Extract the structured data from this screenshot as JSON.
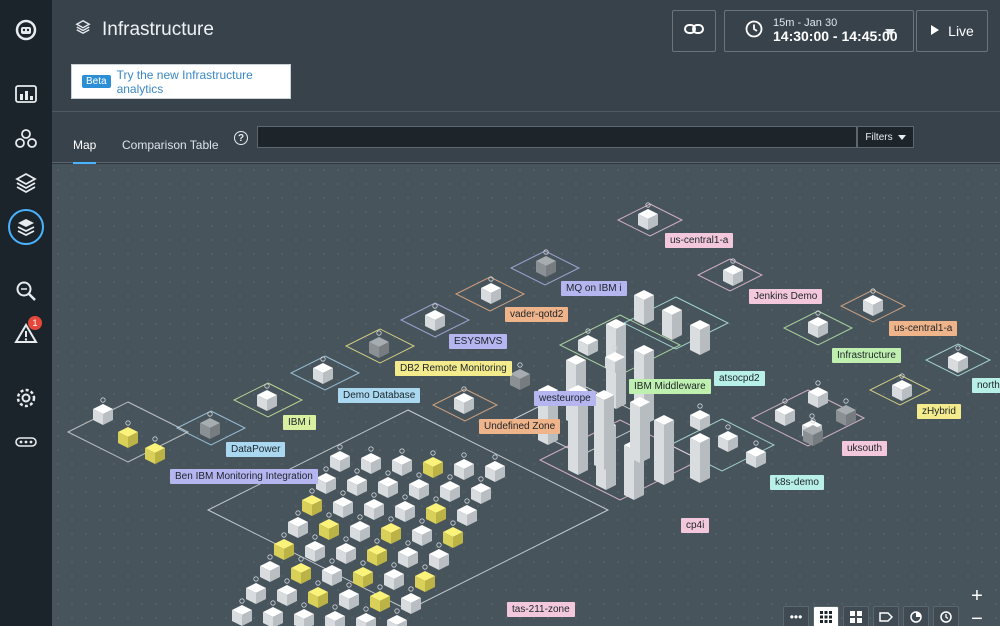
{
  "header": {
    "title": "Infrastructure",
    "time_range": "15m - Jan 30",
    "time_value": "14:30:00 - 14:45:00",
    "live_label": "Live"
  },
  "beta": {
    "tag": "Beta",
    "text": "Try the new Infrastructure analytics"
  },
  "tabs": [
    {
      "label": "Map",
      "active": true
    },
    {
      "label": "Comparison Table",
      "active": false
    }
  ],
  "search": {
    "value": "",
    "placeholder": ""
  },
  "filters_label": "Filters",
  "sidebar": {
    "items": [
      {
        "icon": "instana-logo-icon"
      },
      {
        "icon": "dashboard-icon"
      },
      {
        "icon": "applications-icon"
      },
      {
        "icon": "platforms-icon"
      },
      {
        "icon": "infrastructure-icon",
        "active": true
      },
      {
        "icon": "analytics-icon"
      },
      {
        "icon": "events-icon",
        "badge": "1"
      },
      {
        "icon": "settings-icon"
      },
      {
        "icon": "more-icon"
      }
    ]
  },
  "map": {
    "zones": [
      {
        "name": "us-central1-a",
        "color": "#f4c8dc"
      },
      {
        "name": "Jenkins Demo",
        "color": "#f4c8dc"
      },
      {
        "name": "us-central1-a",
        "color": "#f0b48a"
      },
      {
        "name": "MQ on IBM i",
        "color": "#b5b5f0"
      },
      {
        "name": "vader-qotd2",
        "color": "#f0b48a"
      },
      {
        "name": "ESYSMVS",
        "color": "#b5b5f0"
      },
      {
        "name": "DB2 Remote Monitoring",
        "color": "#f4eb8c"
      },
      {
        "name": "Demo Database",
        "color": "#a9d8f0"
      },
      {
        "name": "IBM i",
        "color": "#d8f0a0"
      },
      {
        "name": "DataPower",
        "color": "#a9d8f0"
      },
      {
        "name": "Ben IBM Monitoring Integration",
        "color": "#b5b5f0"
      },
      {
        "name": "Undefined Zone",
        "color": "#f0b48a"
      },
      {
        "name": "westeurope",
        "color": "#b5b5f0"
      },
      {
        "name": "IBM Middleware",
        "color": "#c0f0b0"
      },
      {
        "name": "atsocpd2",
        "color": "#b8f0e8"
      },
      {
        "name": "Infrastructure",
        "color": "#c0f0b0"
      },
      {
        "name": "zHybrid",
        "color": "#f4eb8c"
      },
      {
        "name": "north",
        "color": "#b8f0e8"
      },
      {
        "name": "uksouth",
        "color": "#f4c8dc"
      },
      {
        "name": "k8s-demo",
        "color": "#b8f0e8"
      },
      {
        "name": "cp4i",
        "color": "#f4c8dc"
      },
      {
        "name": "tas-211-zone",
        "color": "#f4c8dc"
      }
    ]
  },
  "controls": {
    "zoom_in": "+",
    "zoom_out": "−",
    "toolbar": [
      {
        "icon": "more-horizontal-icon"
      },
      {
        "icon": "grid-layout-icon",
        "active": true
      },
      {
        "icon": "group-layout-icon"
      },
      {
        "icon": "tag-icon"
      },
      {
        "icon": "pie-chart-icon"
      },
      {
        "icon": "clock-icon"
      }
    ]
  }
}
